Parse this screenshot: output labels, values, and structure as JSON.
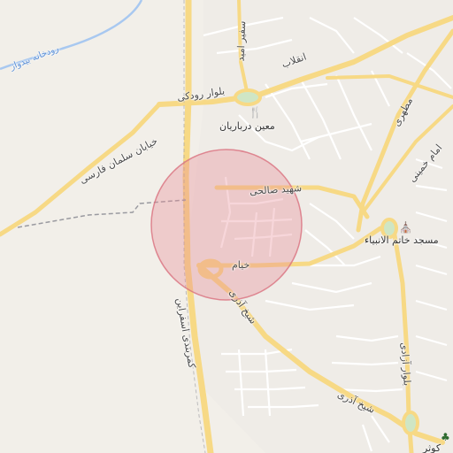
{
  "map": {
    "labels": {
      "river": "رودخانه بیدواز",
      "boulevard_rudaki": "بلوار رودکی",
      "enghelab": "انقلاب",
      "safir_omid": "سفیر امید",
      "salman_farsi": "خیابان سلمان فارسی",
      "moein_darbarian": "معین درباریان",
      "motahari": "مطهری",
      "imam_khomeini": "امام خمینی",
      "shahid_salehi": "شهید صالحی",
      "khatam_mosque": "مسجد خاتم الانبیاء",
      "khayyam": "خیام",
      "sheikh_azari_1": "شیخ آذری",
      "sheikh_azari_2": "شیخ آذری",
      "kamarbandi": "کمربندی اسفراین",
      "azadi": "بلوار آزادی",
      "kosh": "کوثر"
    },
    "icons": {
      "restaurant": "fork-knife-icon",
      "mosque": "mosque-icon",
      "park": "tree-icon"
    },
    "colors": {
      "background": "#f2efe9",
      "major_road": "#f7d985",
      "minor_road": "#ffffff",
      "water": "#a8c8f0",
      "highlight_circle": "#e88a96",
      "park": "#cfe6c5"
    }
  }
}
